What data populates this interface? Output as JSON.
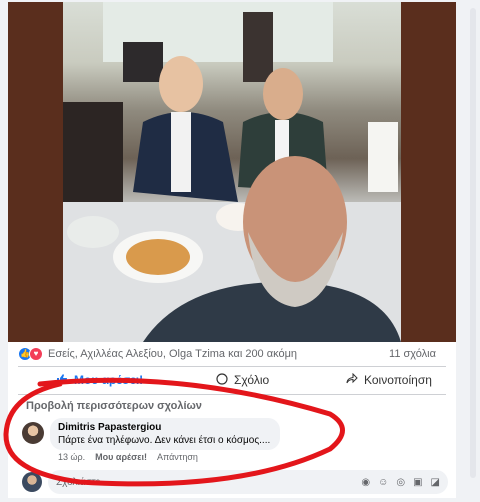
{
  "post": {
    "reactions_text": "Εσείς, Αχιλλέας Αλεξίου, Olga Tzima και 200 ακόμη",
    "comments_count": "11 σχόλια"
  },
  "actions": {
    "like": "Μου αρέσει!",
    "comment": "Σχόλιο",
    "share": "Κοινοποίηση"
  },
  "comments": {
    "view_more": "Προβολή περισσότερων σχολίων",
    "items": [
      {
        "author": "Dimitris Papastergiou",
        "text": "Πάρτε ένα τηλέφωνο. Δεν κάνει έτσι ο κόσμος....",
        "time": "13 ώρ.",
        "like": "Μου αρέσει!",
        "reply": "Απάντηση"
      }
    ]
  },
  "composer": {
    "placeholder": "Σχολιάστε..."
  },
  "colors": {
    "accent": "#1877f2",
    "annotation": "#e3161b",
    "frame": "#5a2e1d"
  }
}
